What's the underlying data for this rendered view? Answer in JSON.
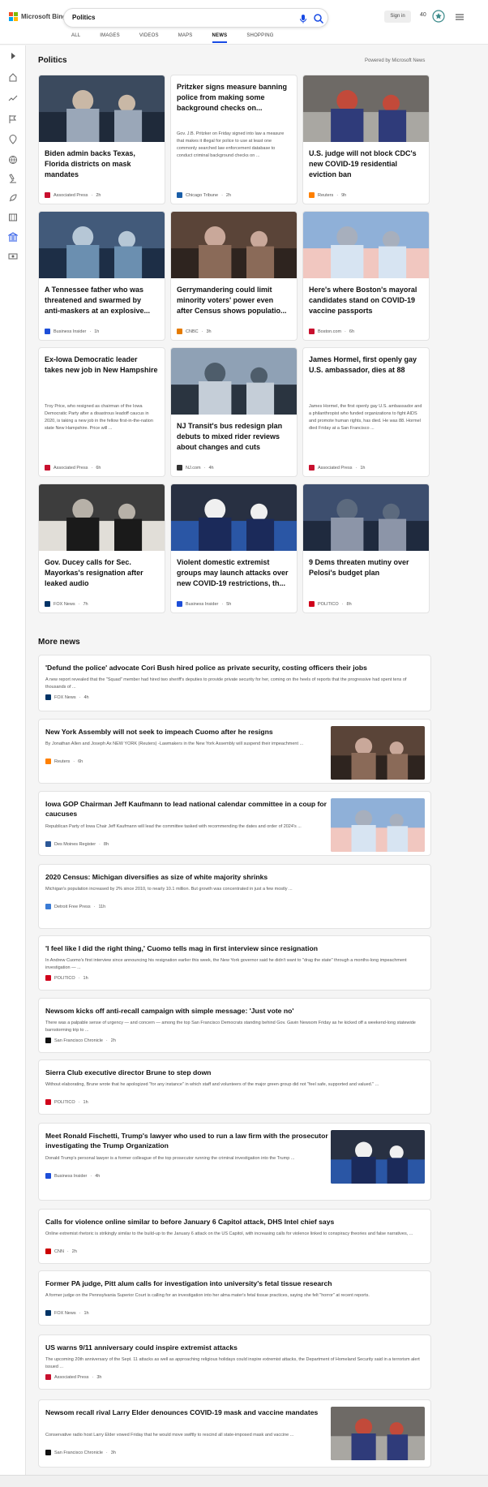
{
  "header": {
    "logo_text": "Microsoft Bing",
    "search_value": "Politics",
    "signin_label": "Sign in",
    "points": "40"
  },
  "tabs": [
    "ALL",
    "IMAGES",
    "VIDEOS",
    "MAPS",
    "NEWS",
    "SHOPPING"
  ],
  "active_tab": "NEWS",
  "politics": {
    "title": "Politics",
    "powered": "Powered by Microsoft News",
    "cards": [
      {
        "title": "Biden admin backs Texas, Florida districts on mask mandates",
        "snippet": "",
        "source": "Associated Press",
        "time": "2h",
        "src_color": "#c8102e"
      },
      {
        "title": "Pritzker signs measure banning police from making some background checks on...",
        "snippet": "Gov. J.B. Pritzker on Friday signed into law a measure that makes it illegal for police to use at least one commonly searched law enforcement database to conduct criminal background checks on ...",
        "source": "Chicago Tribune",
        "time": "2h",
        "src_color": "#1a5ea8"
      },
      {
        "title": "U.S. judge will not block CDC's new COVID-19 residential eviction ban",
        "snippet": "",
        "source": "Reuters",
        "time": "9h",
        "src_color": "#ff8000"
      },
      {
        "title": "A Tennessee father who was threatened and swarmed by anti-maskers at an explosive...",
        "snippet": "",
        "source": "Business Insider",
        "time": "1h",
        "src_color": "#1d4ed8"
      },
      {
        "title": "Gerrymandering could limit minority voters' power even after Census shows populatio...",
        "snippet": "",
        "source": "CNBC",
        "time": "3h",
        "src_color": "#e57b00"
      },
      {
        "title": "Here's where Boston's mayoral candidates stand on COVID-19 vaccine passports",
        "snippet": "",
        "source": "Boston.com",
        "time": "6h",
        "src_color": "#c8102e"
      },
      {
        "title": "Ex-Iowa Democratic leader takes new job in New Hampshire",
        "snippet": "Troy Price, who resigned as chairman of the Iowa Democratic Party after a disastrous leadoff caucus in 2020, is taking a new job in the fellow first-in-the-nation state New Hampshire. Price will ...",
        "source": "Associated Press",
        "time": "6h",
        "src_color": "#c8102e"
      },
      {
        "title": "NJ Transit's bus redesign plan debuts to mixed rider reviews about changes and cuts",
        "snippet": "",
        "source": "NJ.com",
        "time": "4h",
        "src_color": "#333333"
      },
      {
        "title": "James Hormel, first openly gay U.S. ambassador, dies at 88",
        "snippet": "James Hormel, the first openly gay U.S. ambassador and a philanthropist who funded organizations to fight AIDS and promote human rights, has died. He was 88. Hormel died Friday at a San Francisco ...",
        "source": "Associated Press",
        "time": "1h",
        "src_color": "#c8102e"
      },
      {
        "title": "Gov. Ducey calls for Sec. Mayorkas's resignation after leaked audio",
        "snippet": "",
        "source": "FOX News",
        "time": "7h",
        "src_color": "#003366"
      },
      {
        "title": "Violent domestic extremist groups may launch attacks over new COVID-19 restrictions, th...",
        "snippet": "",
        "source": "Business Insider",
        "time": "5h",
        "src_color": "#1d4ed8"
      },
      {
        "title": "9 Dems threaten mutiny over Pelosi's budget plan",
        "snippet": "",
        "source": "POLITICO",
        "time": "8h",
        "src_color": "#d0021b"
      }
    ]
  },
  "more": {
    "title": "More news",
    "items": [
      {
        "title": "'Defund the police' advocate Cori Bush hired police as private security, costing officers their jobs",
        "snippet": "A new report revealed that the \"Squad\" member had hired two sheriff's deputies to provide private security for her, coming on the heels of reports that the progressive had spent tens of thousands of ...",
        "source": "FOX News",
        "time": "4h",
        "src_color": "#003366",
        "img": false
      },
      {
        "title": "New York Assembly will not seek to impeach Cuomo after he resigns",
        "snippet": "By Jonathan Allen and Joseph Ax NEW YORK (Reuters) -Lawmakers in the New York Assembly will suspend their impeachment ...",
        "source": "Reuters",
        "time": "6h",
        "src_color": "#ff8000",
        "img": true
      },
      {
        "title": "Iowa GOP Chairman Jeff Kaufmann to lead national calendar committee in a coup for caucuses",
        "snippet": "Republican Party of Iowa Chair Jeff Kaufmann will lead the committee tasked with recommending the dates and order of 2024's ...",
        "source": "Des Moines Register",
        "time": "8h",
        "src_color": "#2b5797",
        "img": true
      },
      {
        "title": "2020 Census: Michigan diversifies as size of white majority shrinks",
        "snippet": "Michigan's population increased by 2% since 2010, to nearly 10.1 million. But growth was concentrated in just a few mostly ...",
        "source": "Detroit Free Press",
        "time": "11h",
        "src_color": "#3a7bd5",
        "img": true
      },
      {
        "title": "'I feel like I did the right thing,' Cuomo tells mag in first interview since resignation",
        "snippet": "In Andrew Cuomo's first interview since announcing his resignation earlier this week, the New York governor said he didn't want to \"drag the state\" through a months-long impeachment investigation — ...",
        "source": "POLITICO",
        "time": "1h",
        "src_color": "#d0021b",
        "img": false
      },
      {
        "title": "Newsom kicks off anti-recall campaign with simple message: 'Just vote no'",
        "snippet": "There was a palpable sense of urgency — and concern — among the top San Francisco Democrats standing behind Gov. Gavin Newsom Friday as he kicked off a weekend-long statewide barnstorming trip to ...",
        "source": "San Francisco Chronicle",
        "time": "2h",
        "src_color": "#111111",
        "img": false
      },
      {
        "title": "Sierra Club executive director Brune to step down",
        "snippet": "Without elaborating, Brune wrote that he apologized \"for any instance\" in which staff and volunteers of the major green group did not \"feel safe, supported and valued.\" ...",
        "source": "POLITICO",
        "time": "1h",
        "src_color": "#d0021b",
        "img": false
      },
      {
        "title": "Meet Ronald Fischetti, Trump's lawyer who used to run a law firm with the prosecutor investigating the Trump Organization",
        "snippet": "Donald Trump's personal lawyer is a former colleague of the top prosecutor running the criminal investigation into the Trump ...",
        "source": "Business Insider",
        "time": "4h",
        "src_color": "#1d4ed8",
        "img": true
      },
      {
        "title": "Calls for violence online similar to before January 6 Capitol attack, DHS Intel chief says",
        "snippet": "Online extremist rhetoric is strikingly similar to the build-up to the January 6 attack on the US Capitol, with increasing calls for violence linked to conspiracy theories and false narratives, ...",
        "source": "CNN",
        "time": "2h",
        "src_color": "#cc0000",
        "img": false
      },
      {
        "title": "Former PA judge, Pitt alum calls for investigation into university's fetal tissue research",
        "snippet": "A former judge on the Pennsylvania Superior Court is calling for an investigation into her alma mater's fetal tissue practices, saying she felt \"horror\" at recent reports.",
        "source": "FOX News",
        "time": "1h",
        "src_color": "#003366",
        "img": false
      },
      {
        "title": "US warns 9/11 anniversary could inspire extremist attacks",
        "snippet": "The upcoming 20th anniversary of the Sept. 11 attacks as well as approaching religious holidays could inspire extremist attacks, the Department of Homeland Security said in a terrorism alert issued ...",
        "source": "Associated Press",
        "time": "3h",
        "src_color": "#c8102e",
        "img": false
      },
      {
        "title": "Newsom recall rival Larry Elder denounces COVID-19 mask and vaccine mandates",
        "snippet": "Conservative radio host Larry Elder vowed Friday that he would move swiftly to rescind all state-imposed mask and vaccine ...",
        "source": "San Francisco Chronicle",
        "time": "3h",
        "src_color": "#111111",
        "img": true
      }
    ]
  }
}
